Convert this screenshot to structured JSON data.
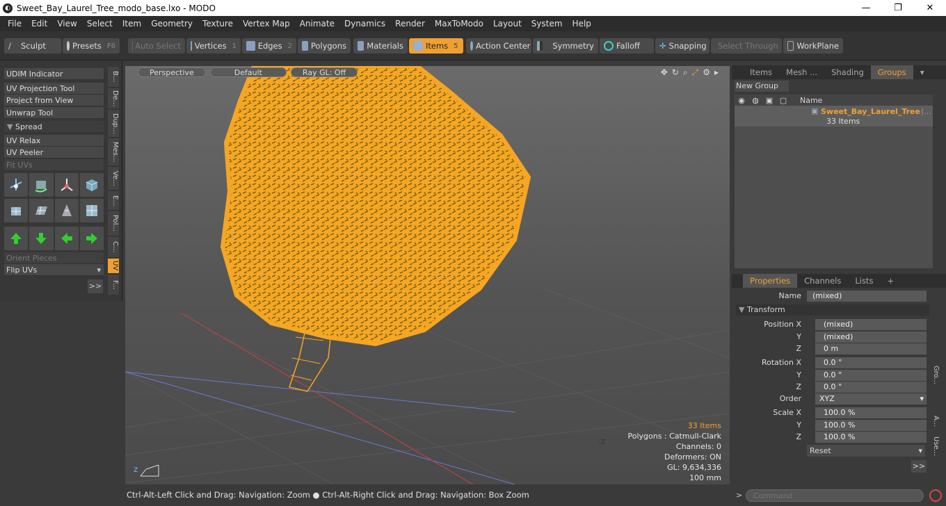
{
  "window": {
    "title": "Sweet_Bay_Laurel_Tree_modo_base.lxo - MODO",
    "app_icon": "modo-logo-icon"
  },
  "menu": [
    "File",
    "Edit",
    "View",
    "Select",
    "Item",
    "Geometry",
    "Texture",
    "Vertex Map",
    "Animate",
    "Dynamics",
    "Render",
    "MaxToModo",
    "Layout",
    "System",
    "Help"
  ],
  "toolbar": {
    "sculpt": "Sculpt",
    "presets": "Presets",
    "presets_key": "F6",
    "auto_select": "Auto Select",
    "vertices": "Vertices",
    "vertices_num": "1",
    "edges": "Edges",
    "edges_num": "2",
    "polygons": "Polygons",
    "materials": "Materials",
    "items": "Items",
    "items_num": "5",
    "action_center": "Action Center",
    "symmetry": "Symmetry",
    "falloff": "Falloff",
    "snapping": "Snapping",
    "select_through": "Select Through",
    "workplane": "WorkPlane"
  },
  "left_panel": {
    "udim": "UDIM Indicator",
    "uv_projection": "UV Projection Tool",
    "project_from_view": "Project from View",
    "unwrap": "Unwrap Tool",
    "spread": "Spread",
    "uv_relax": "UV Relax",
    "uv_peeler": "UV Peeler",
    "fit_uvs": "Fit UVs",
    "orient_pieces": "Orient Pieces",
    "flip_uvs": "Flip UVs",
    "more": ">>"
  },
  "vertical_tabs": [
    "B...",
    "De...",
    "Dup...",
    "Mes...",
    "Ve...",
    "E...",
    "Pol...",
    "C...",
    "UV",
    "F..."
  ],
  "viewport": {
    "perspective": "Perspective",
    "shading": "Default",
    "raygl": "Ray GL: Off",
    "axis_label": "-Z",
    "info": {
      "items": "33 Items",
      "polygons": "Polygons : Catmull-Clark",
      "channels": "Channels: 0",
      "deformers": "Deformers: ON",
      "gl": "GL: 9,634,336",
      "scale": "100 mm"
    }
  },
  "groups_panel": {
    "tabs": [
      "Items",
      "Mesh ...",
      "Shading",
      "Groups"
    ],
    "active_tab": "Groups",
    "new_group": "New Group",
    "name_header": "Name",
    "group_name": "Sweet_Bay_Laurel_Tree",
    "group_suffix": "(...",
    "group_count": "33 Items"
  },
  "properties_panel": {
    "tabs": [
      "Properties",
      "Channels",
      "Lists"
    ],
    "add_tab": "+",
    "name_label": "Name",
    "name_value": "(mixed)",
    "transform": "Transform",
    "position_label": "Position X",
    "pos_x": "(mixed)",
    "pos_y": "(mixed)",
    "pos_z": "0 m",
    "rotation_label": "Rotation X",
    "rot_x": "0.0 °",
    "rot_y": "0.0 °",
    "rot_z": "0.0 °",
    "order_label": "Order",
    "order_value": "XYZ",
    "scale_label": "Scale X",
    "scale_x": "100.0 %",
    "scale_y": "100.0 %",
    "scale_z": "100.0 %",
    "y": "Y",
    "z": "Z",
    "reset": "Reset",
    "more": ">>",
    "side_tabs": [
      "Gro...",
      "A...",
      "Use..."
    ]
  },
  "status": {
    "hint1": "Ctrl-Alt-Left Click and Drag: Navigation: Zoom",
    "hint2": "Ctrl-Alt-Right Click and Drag: Navigation: Box Zoom"
  },
  "command": {
    "placeholder": "Command",
    "prompt": ">"
  },
  "colors": {
    "accent": "#f0a030",
    "foliage": "#f5a623",
    "foliage_dark": "#6b5a10"
  }
}
